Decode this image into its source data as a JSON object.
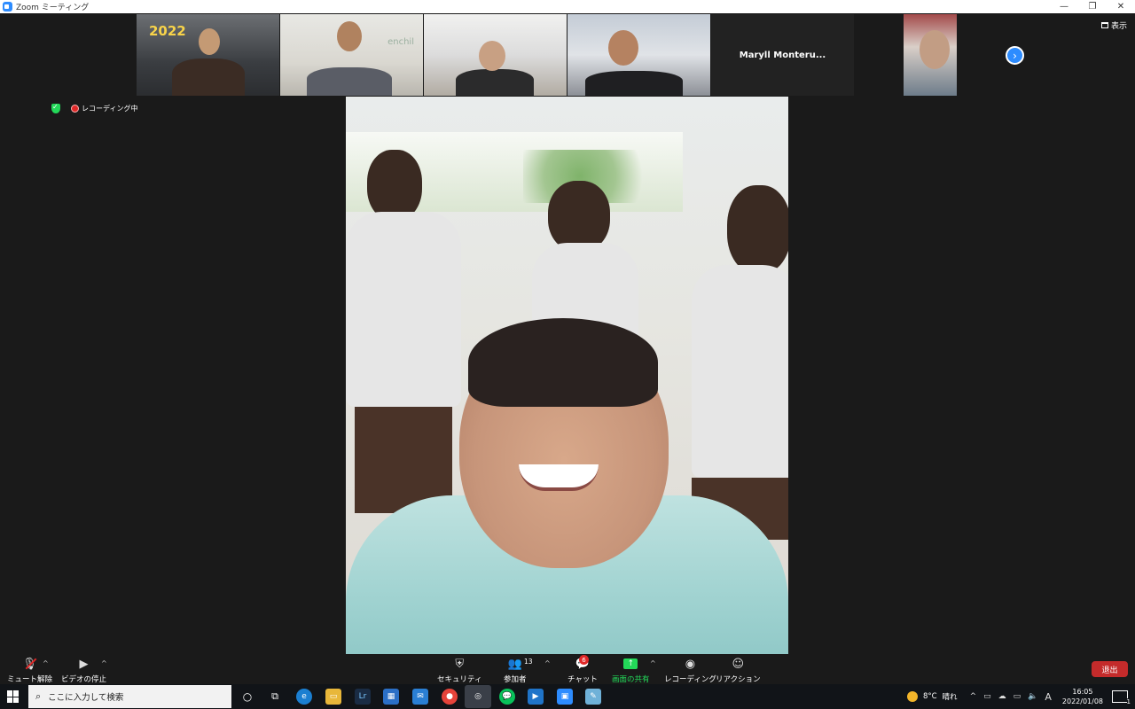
{
  "window": {
    "title": "Zoom ミーティング",
    "minimize": "—",
    "restore": "❐",
    "close": "✕"
  },
  "thumbnails": {
    "name_tile": "Maryll  Monteru...",
    "next_icon": "chevron-right-icon",
    "view_label": "表示",
    "banner_2022": "2022",
    "brand_text": "enchil"
  },
  "status": {
    "recording_label": "レコーディング中"
  },
  "toolbar": {
    "mute_label": "ミュート解除",
    "video_label": "ビデオの停止",
    "security_label": "セキュリティ",
    "participants_label": "参加者",
    "participants_count": "13",
    "chat_label": "チャット",
    "chat_badge": "6",
    "share_label": "画面の共有",
    "record_label": "レコーディング",
    "reactions_label": "リアクション",
    "leave_label": "退出"
  },
  "taskbar": {
    "search_placeholder": "ここに入力して検索",
    "lr_label": "Lr",
    "weather_temp": "8°C",
    "weather_text": "晴れ",
    "ime": "A",
    "time": "16:05",
    "date": "2022/01/08",
    "notif_count": "1"
  },
  "colors": {
    "accent_blue": "#2d8cff",
    "share_green": "#23d959",
    "leave_red": "#c42b2b",
    "badge_red": "#e02828"
  }
}
